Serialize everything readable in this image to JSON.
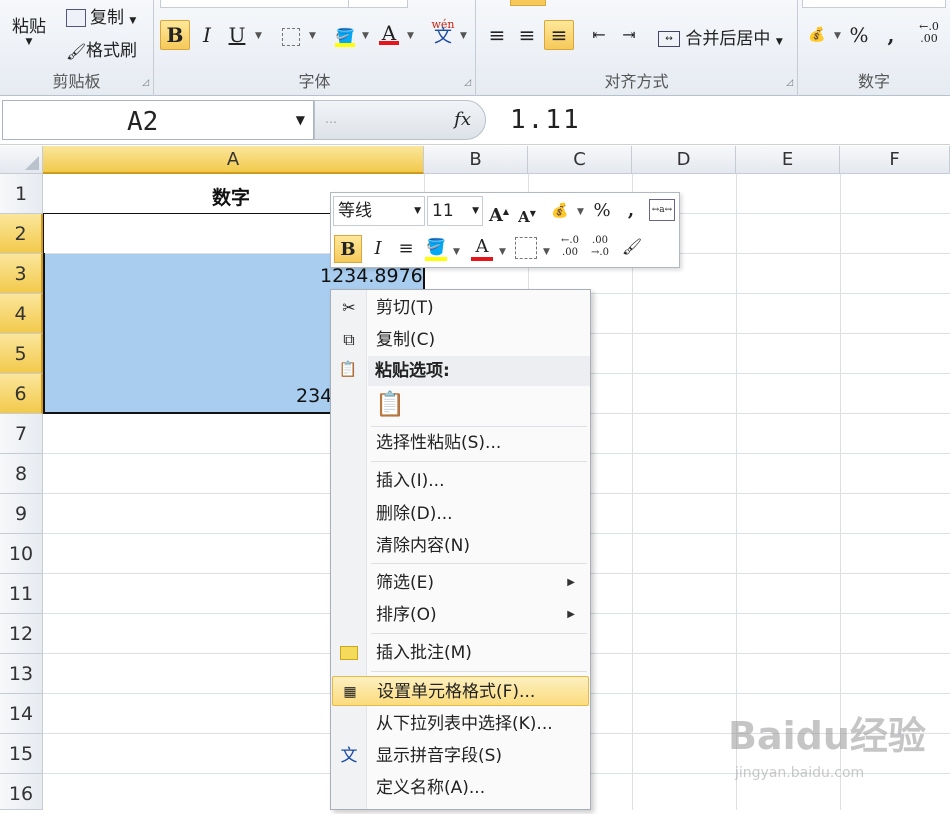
{
  "ribbon": {
    "clipboard": {
      "paste": "粘贴",
      "copy": "复制",
      "format_painter": "格式刷",
      "group": "剪贴板"
    },
    "font": {
      "group": "字体",
      "bold": "B",
      "italic": "I",
      "underline": "U",
      "font_color": "A",
      "phonetic": "wén"
    },
    "alignment": {
      "group": "对齐方式",
      "merge": "合并后居中"
    },
    "number": {
      "group": "数字",
      "percent": "%",
      "comma": ","
    }
  },
  "formula_bar": {
    "name_box": "A2",
    "fx": "fx",
    "value": "1.11"
  },
  "grid": {
    "columns": [
      "A",
      "B",
      "C",
      "D",
      "E",
      "F"
    ],
    "rows": [
      "1",
      "2",
      "3",
      "4",
      "5",
      "6",
      "7",
      "8",
      "9",
      "10",
      "11",
      "12",
      "13",
      "14",
      "15",
      "16"
    ],
    "cells": {
      "a1": "数字",
      "a3": "1234.8976",
      "a6": "234"
    }
  },
  "mini_toolbar": {
    "font": "等线",
    "size": "11",
    "percent": "%",
    "comma": ","
  },
  "context_menu": {
    "cut": "剪切(T)",
    "copy": "复制(C)",
    "paste_options": "粘贴选项:",
    "paste_special": "选择性粘贴(S)...",
    "insert": "插入(I)...",
    "delete": "删除(D)...",
    "clear": "清除内容(N)",
    "filter": "筛选(E)",
    "sort": "排序(O)",
    "insert_comment": "插入批注(M)",
    "format_cells": "设置单元格格式(F)...",
    "pick_list": "从下拉列表中选择(K)...",
    "phonetic": "显示拼音字段(S)",
    "define_name": "定义名称(A)..."
  },
  "watermark": {
    "text": "Baidu经验",
    "sub": "jingyan.baidu.com"
  },
  "colors": {
    "selection": "#a9cdef",
    "highlight": "#fbdc7d",
    "header_selected": "#f2c94b"
  }
}
